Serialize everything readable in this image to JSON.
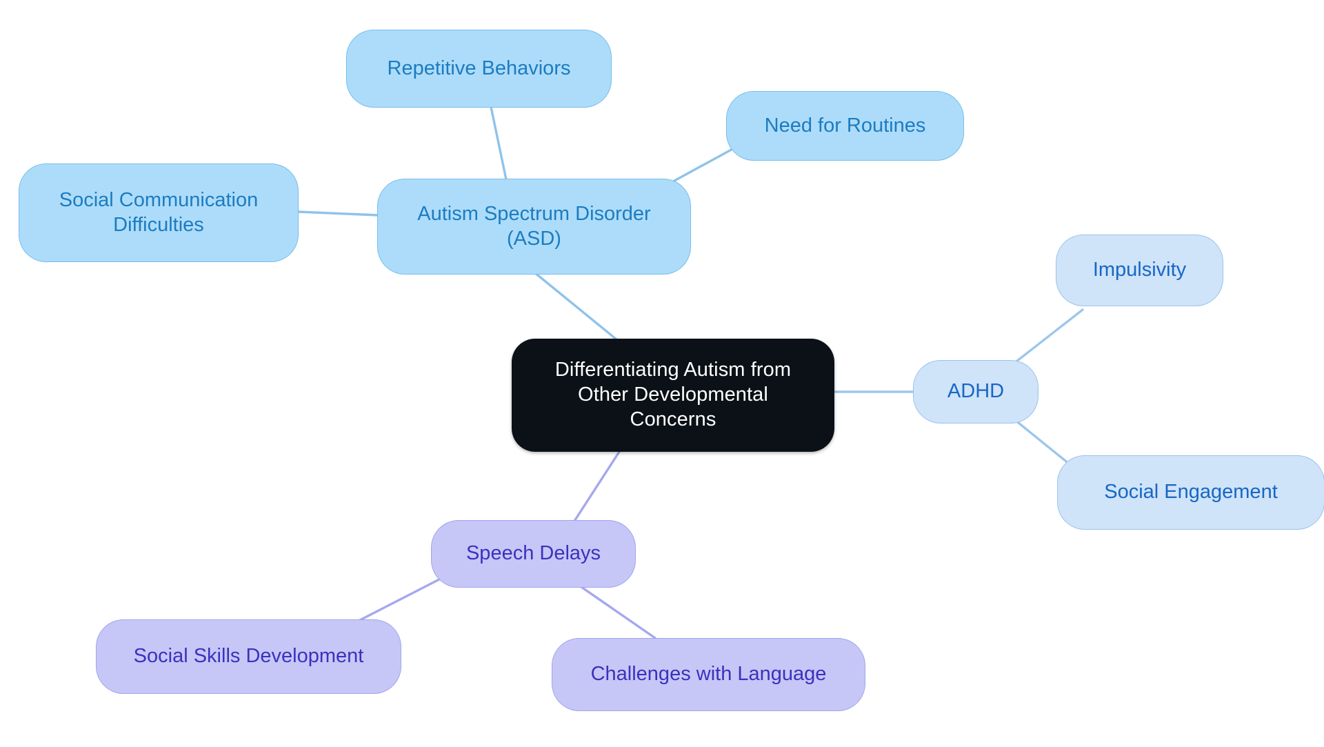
{
  "diagram": {
    "type": "mindmap",
    "title": "Differentiating Autism from Other Developmental Concerns",
    "background_color": "#ffffff",
    "palettes": {
      "root_fill": "#0b1117",
      "root_text": "#ffffff",
      "asd_fill": "#addcfa",
      "asd_text": "#1c7cc0",
      "asd_border": "#76bdec",
      "adhd_fill": "#cfe3f9",
      "adhd_text": "#1767c4",
      "adhd_border": "#9cc3ea",
      "speech_fill": "#c6c7f6",
      "speech_text": "#3b31bf",
      "speech_border": "#a2a4ee",
      "blue_edge": "#8fc3ea",
      "light_blue_edge": "#9cc7ec",
      "purple_edge": "#a5a8ee"
    }
  },
  "nodes": {
    "root": {
      "label": "Differentiating Autism from\nOther Developmental\nConcerns"
    },
    "asd": {
      "label": "Autism Spectrum Disorder\n(ASD)"
    },
    "social_communication": {
      "label": "Social Communication\nDifficulties"
    },
    "repetitive_behaviors": {
      "label": "Repetitive Behaviors"
    },
    "need_for_routines": {
      "label": "Need for Routines"
    },
    "adhd": {
      "label": "ADHD"
    },
    "impulsivity": {
      "label": "Impulsivity"
    },
    "social_engagement": {
      "label": "Social Engagement"
    },
    "speech_delays": {
      "label": "Speech Delays"
    },
    "social_skills_development": {
      "label": "Social Skills Development"
    },
    "challenges_with_language": {
      "label": "Challenges with Language"
    }
  },
  "edges": [
    {
      "from": "root",
      "to": "asd",
      "color": "#8fc3ea"
    },
    {
      "from": "asd",
      "to": "social_communication",
      "color": "#8fc3ea"
    },
    {
      "from": "asd",
      "to": "repetitive_behaviors",
      "color": "#8fc3ea"
    },
    {
      "from": "asd",
      "to": "need_for_routines",
      "color": "#8fc3ea"
    },
    {
      "from": "root",
      "to": "adhd",
      "color": "#9cc7ec"
    },
    {
      "from": "adhd",
      "to": "impulsivity",
      "color": "#9cc7ec"
    },
    {
      "from": "adhd",
      "to": "social_engagement",
      "color": "#9cc7ec"
    },
    {
      "from": "root",
      "to": "speech_delays",
      "color": "#a5a8ee"
    },
    {
      "from": "speech_delays",
      "to": "social_skills_development",
      "color": "#a5a8ee"
    },
    {
      "from": "speech_delays",
      "to": "challenges_with_language",
      "color": "#a5a8ee"
    }
  ]
}
